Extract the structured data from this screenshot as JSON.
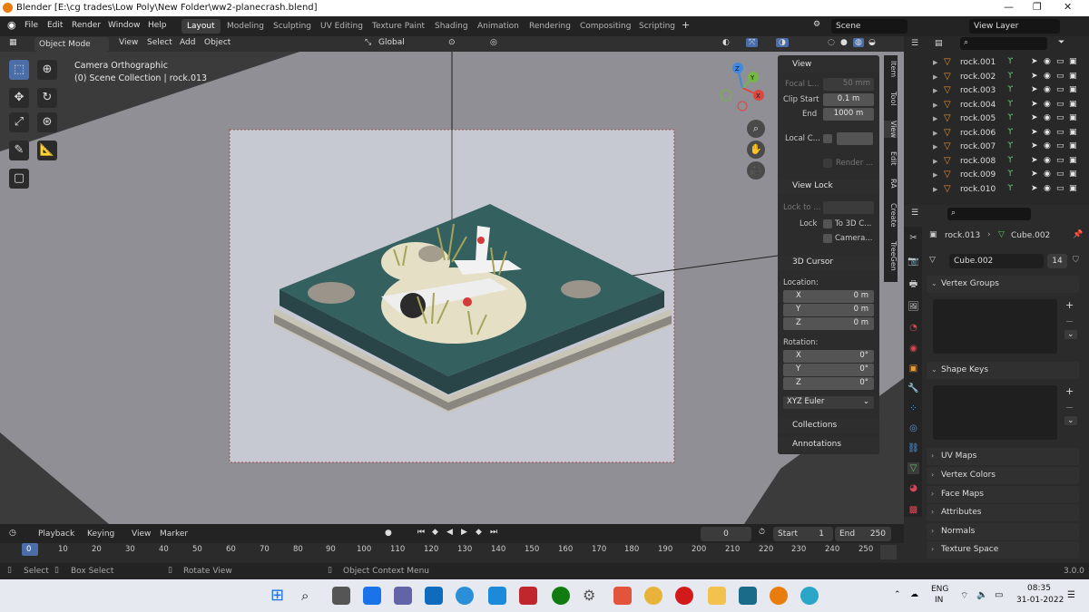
{
  "window": {
    "title": "Blender [E:\\cg trades\\Low Poly\\New Folder\\ww2-planecrash.blend]",
    "controls": [
      "—",
      "❐",
      "✕"
    ]
  },
  "menu": {
    "items": [
      "File",
      "Edit",
      "Render",
      "Window",
      "Help"
    ],
    "workspaces": [
      "Layout",
      "Modeling",
      "Sculpting",
      "UV Editing",
      "Texture Paint",
      "Shading",
      "Animation",
      "Rendering",
      "Compositing",
      "Scripting"
    ],
    "active_workspace": "Layout",
    "add_tab": "+",
    "scene": "Scene",
    "view_layer": "View Layer"
  },
  "viewport_header": {
    "mode": "Object Mode",
    "menus": [
      "View",
      "Select",
      "Add",
      "Object"
    ],
    "transform": "Global"
  },
  "viewport": {
    "camera_label": "Camera Orthographic",
    "collection_label": "(0) Scene Collection | rock.013",
    "gizmo_axes": [
      "X",
      "Y",
      "Z"
    ],
    "colors": {
      "x": "#e0453f",
      "y": "#74b843",
      "z": "#3f8ae0"
    }
  },
  "npanel": {
    "view_header": "View",
    "focal_label": "Focal L...",
    "focal_value": "50 mm",
    "clip_start_label": "Clip Start",
    "clip_start_value": "0.1 m",
    "end_label": "End",
    "end_value": "1000 m",
    "local_camera_label": "Local C...",
    "render_label": "Render ...",
    "view_lock_header": "View Lock",
    "lock_to_label": "Lock to ...",
    "lock_label": "Lock",
    "to_3d_cursor": "To 3D C...",
    "camera_to_view": "Camera...",
    "cursor_header": "3D Cursor",
    "location_label": "Location:",
    "location": [
      {
        "axis": "X",
        "value": "0 m"
      },
      {
        "axis": "Y",
        "value": "0 m"
      },
      {
        "axis": "Z",
        "value": "0 m"
      }
    ],
    "rotation_label": "Rotation:",
    "rotation": [
      {
        "axis": "X",
        "value": "0°"
      },
      {
        "axis": "Y",
        "value": "0°"
      },
      {
        "axis": "Z",
        "value": "0°"
      }
    ],
    "rotation_mode": "XYZ Euler",
    "collections_header": "Collections",
    "annotations_header": "Annotations",
    "tabs": [
      "Item",
      "Tool",
      "View",
      "Edit",
      "RA",
      "Create",
      "TreeGen"
    ]
  },
  "outliner": {
    "items": [
      "rock.001",
      "rock.002",
      "rock.003",
      "rock.004",
      "rock.005",
      "rock.006",
      "rock.007",
      "rock.008",
      "rock.009",
      "rock.010"
    ]
  },
  "properties": {
    "object": "rock.013",
    "data": "Cube.002",
    "mesh_name": "Cube.002",
    "users": "14",
    "sections_open": [
      "Vertex Groups",
      "Shape Keys"
    ],
    "sections_closed": [
      "UV Maps",
      "Vertex Colors",
      "Face Maps",
      "Attributes",
      "Normals",
      "Texture Space"
    ]
  },
  "timeline": {
    "menus": [
      "Playback",
      "Keying",
      "View",
      "Marker"
    ],
    "current_frame": "0",
    "start_label": "Start",
    "start": "1",
    "end_label": "End",
    "end": "250",
    "ticks": [
      "0",
      "10",
      "20",
      "30",
      "40",
      "50",
      "60",
      "70",
      "80",
      "90",
      "100",
      "110",
      "120",
      "130",
      "140",
      "150",
      "160",
      "170",
      "180",
      "190",
      "200",
      "210",
      "220",
      "230",
      "240",
      "250"
    ]
  },
  "status": {
    "select": "Select",
    "box_select": "Box Select",
    "rotate_view": "Rotate View",
    "context_menu": "Object Context Menu",
    "version": "3.0.0"
  },
  "taskbar": {
    "lang": "ENG",
    "region": "IN",
    "time": "08:35",
    "date": "31-01-2022"
  }
}
